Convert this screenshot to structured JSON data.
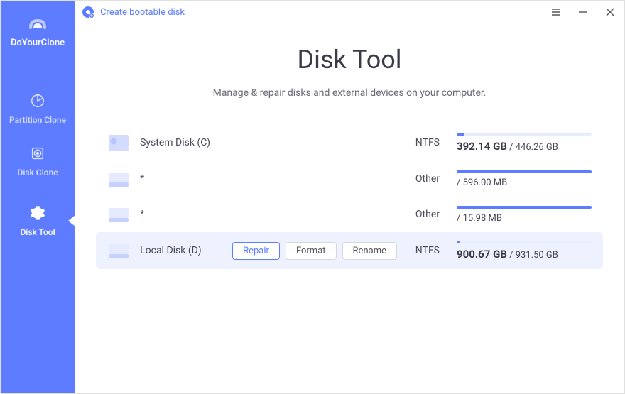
{
  "app": {
    "name": "DoYourClone"
  },
  "sidebar": {
    "items": [
      {
        "label": "Partition Clone"
      },
      {
        "label": "Disk Clone"
      },
      {
        "label": "Disk Tool"
      }
    ]
  },
  "titlebar": {
    "create_bootable": "Create bootable disk"
  },
  "page": {
    "title": "Disk Tool",
    "subtitle": "Manage & repair disks and external devices on your computer."
  },
  "disks": [
    {
      "name": "System Disk (C)",
      "fs": "NTFS",
      "used": "392.14 GB",
      "total": "446.26 GB",
      "fill_pct": 6
    },
    {
      "name": "*",
      "fs": "Other",
      "used": "",
      "total": "596.00 MB",
      "fill_pct": 100
    },
    {
      "name": "*",
      "fs": "Other",
      "used": "",
      "total": "15.98 MB",
      "fill_pct": 100
    },
    {
      "name": "Local Disk (D)",
      "fs": "NTFS",
      "used": "900.67 GB",
      "total": "931.50 GB",
      "fill_pct": 2,
      "selected": true
    }
  ],
  "actions": {
    "repair": "Repair",
    "format": "Format",
    "rename": "Rename"
  }
}
